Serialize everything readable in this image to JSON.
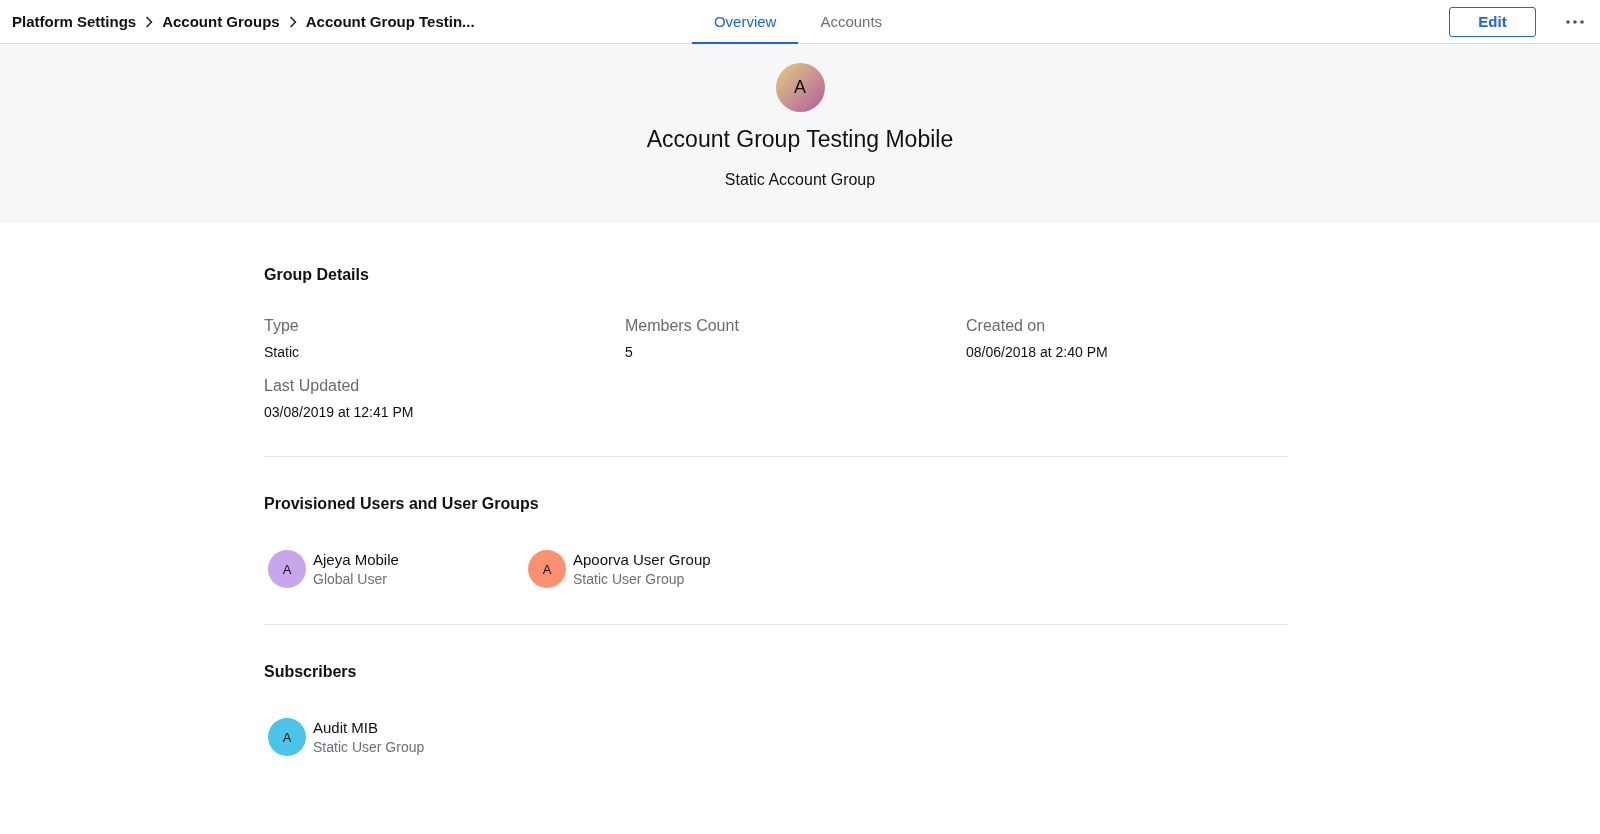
{
  "breadcrumbs": [
    "Platform Settings",
    "Account Groups",
    "Account Group Testin..."
  ],
  "tabs": [
    {
      "label": "Overview",
      "selected": true
    },
    {
      "label": "Accounts",
      "selected": false
    }
  ],
  "edit_button": "Edit",
  "hero": {
    "avatar": "A",
    "title": "Account Group Testing Mobile",
    "subtitle": "Static Account Group"
  },
  "group_details": {
    "heading": "Group Details",
    "fields": [
      {
        "label": "Type",
        "value": "Static"
      },
      {
        "label": "Members Count",
        "value": "5"
      },
      {
        "label": "Created on",
        "value": "08/06/2018 at 2:40 PM"
      },
      {
        "label": "Last Updated",
        "value": "03/08/2019 at 12:41 PM"
      }
    ]
  },
  "provisioned": {
    "heading": "Provisioned Users and User Groups",
    "items": [
      {
        "avatar": "A",
        "name": "Ajeya Mobile",
        "role": "Global User",
        "color": "#c8a6ec"
      },
      {
        "avatar": "A",
        "name": "Apoorva User Group",
        "role": "Static User Group",
        "color": "#fb9170"
      }
    ]
  },
  "subscribers": {
    "heading": "Subscribers",
    "items": [
      {
        "avatar": "A",
        "name": "Audit MIB",
        "role": "Static User Group",
        "color": "#4cc4ea"
      }
    ]
  }
}
